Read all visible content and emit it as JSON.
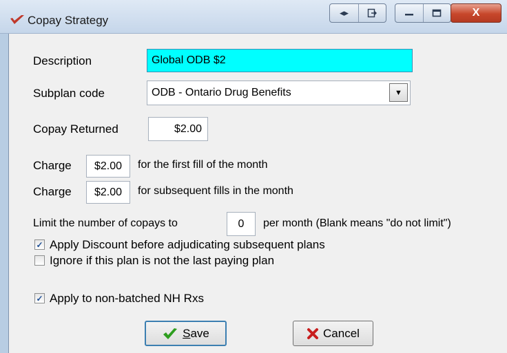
{
  "window": {
    "title": "Copay Strategy",
    "close_glyph": "X",
    "icons": [
      "app-check-icon",
      "swap-icon",
      "export-icon",
      "minimize-icon",
      "maximize-icon",
      "close-icon"
    ]
  },
  "form": {
    "description_label": "Description",
    "description_value": "Global ODB $2",
    "subplan_label": "Subplan code",
    "subplan_value": "ODB - Ontario Drug Benefits",
    "copay_returned_label": "Copay Returned",
    "copay_returned_value": "$2.00",
    "charge1_label": "Charge",
    "charge1_value": "$2.00",
    "charge1_suffix": "for the first fill of the month",
    "charge2_label": "Charge",
    "charge2_value": "$2.00",
    "charge2_suffix": "for subsequent fills in the month",
    "limit_label": "Limit the number of copays to",
    "limit_value": "0",
    "limit_suffix": "per month (Blank means \"do not limit\")",
    "chk_apply_discount_label": "Apply Discount before adjudicating subsequent plans",
    "chk_apply_discount_checked": true,
    "chk_ignore_label": "Ignore if this plan is not the last paying plan",
    "chk_ignore_checked": false,
    "chk_nh_label": "Apply to non-batched NH Rxs",
    "chk_nh_checked": true
  },
  "buttons": {
    "save_mnemonic": "S",
    "save_rest": "ave",
    "cancel_label": "Cancel"
  },
  "colors": {
    "description_highlight": "#00ffff",
    "checkmark_green": "#2e9e1f",
    "cancel_x_red": "#c81e1e"
  }
}
